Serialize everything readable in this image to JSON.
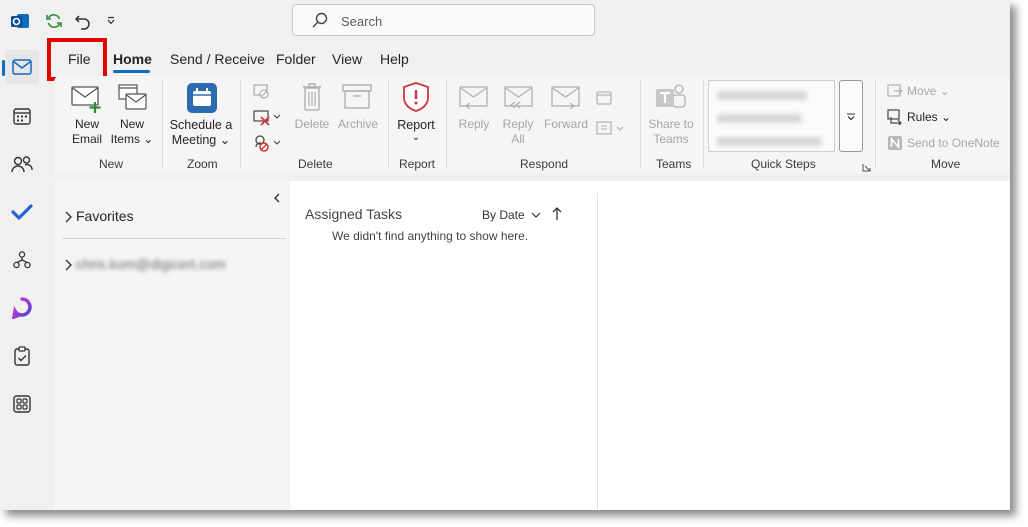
{
  "titlebar": {
    "search_placeholder": "Search"
  },
  "tabs": [
    {
      "label": "File"
    },
    {
      "label": "Home",
      "active": true
    },
    {
      "label": "Send / Receive"
    },
    {
      "label": "Folder"
    },
    {
      "label": "View"
    },
    {
      "label": "Help"
    }
  ],
  "ribbon": {
    "new": {
      "new_email_line1": "New",
      "new_email_line2": "Email",
      "new_items_line1": "New",
      "new_items_line2": "Items ⌄",
      "group": "New"
    },
    "zoom": {
      "schedule_line1": "Schedule a",
      "schedule_line2": "Meeting ⌄",
      "group": "Zoom"
    },
    "delete": {
      "delete": "Delete",
      "archive": "Archive",
      "group": "Delete"
    },
    "report": {
      "report": "Report",
      "group": "Report"
    },
    "respond": {
      "reply": "Reply",
      "reply_all_line1": "Reply",
      "reply_all_line2": "All",
      "forward": "Forward",
      "group": "Respond"
    },
    "teams": {
      "share_line1": "Share to",
      "share_line2": "Teams",
      "group": "Teams"
    },
    "quick_steps": {
      "group": "Quick Steps"
    },
    "move": {
      "move": "Move ⌄",
      "rules": "Rules ⌄",
      "onenote": "Send to OneNote",
      "group": "Move"
    }
  },
  "folder_pane": {
    "favorites": "Favorites",
    "account": "chris.kom@digicert.com"
  },
  "message_list": {
    "title": "Assigned Tasks",
    "sort": "By Date",
    "empty": "We didn't find anything to show here."
  },
  "colors": {
    "accent": "#0f6cbd",
    "highlight": "#e00000",
    "report_red": "#d13438"
  }
}
